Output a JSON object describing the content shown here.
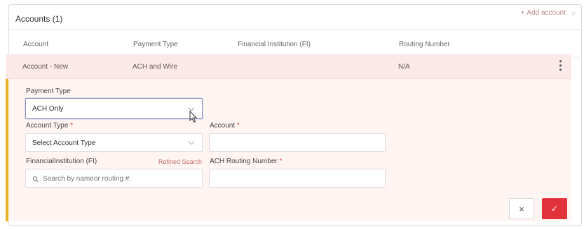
{
  "card": {
    "title": "Accounts (1)",
    "add_account_label": "Add account",
    "add_icon": "+"
  },
  "columns": {
    "account": "Account",
    "payment_type": "Payment Type",
    "financial_institution": "Financial Institution (FI)",
    "routing_number": "Routing Number"
  },
  "row": {
    "account": "Account - New",
    "payment_type": "ACH and Wire",
    "routing_number": "N/A"
  },
  "form": {
    "payment_type_label": "Payment Type",
    "payment_type_value": "ACH Only",
    "account_type_label": "Account Type",
    "account_type_placeholder": "Select Account Type",
    "account_label": "Account",
    "account_value": "",
    "fi_label": "FinancialInstitution (FI)",
    "refined_search_label": "Refined Search",
    "fi_placeholder": "Search by nameor routing #.",
    "ach_routing_label": "ACH Routing Number",
    "ach_routing_value": "",
    "required_mark": "*"
  },
  "actions": {
    "cancel_glyph": "×",
    "save_glyph": "✓"
  },
  "colors": {
    "accent_bar": "#e8b223",
    "row_highlight": "#fbe9e9",
    "save_button": "#e1323c"
  }
}
